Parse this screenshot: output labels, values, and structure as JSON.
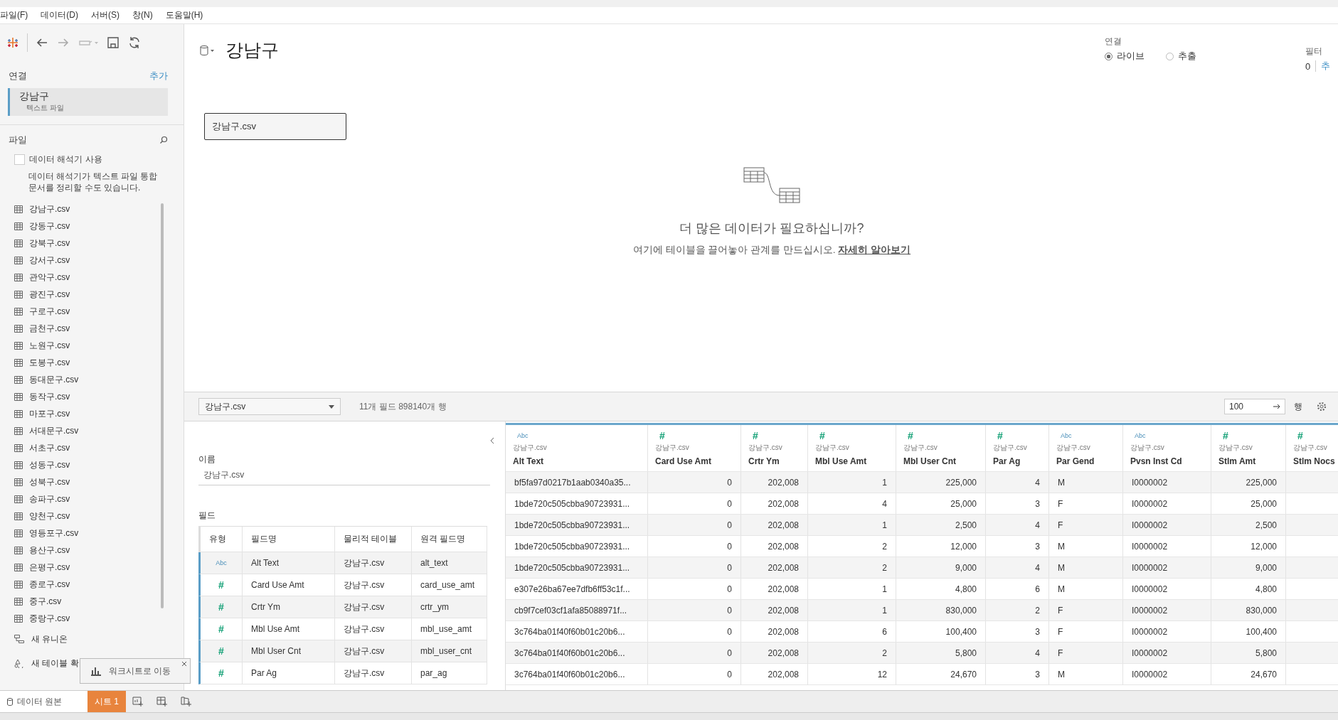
{
  "menu": [
    "파일(F)",
    "데이터(D)",
    "서버(S)",
    "창(N)",
    "도움말(H)"
  ],
  "connections": {
    "title": "연결",
    "add": "추가",
    "items": [
      {
        "name": "강남구",
        "type": "텍스트 파일",
        "selected": true
      }
    ]
  },
  "files": {
    "title": "파일",
    "interpreter": {
      "label": "데이터 해석기 사용",
      "checked": false,
      "note": "데이터 해석기가 텍스트 파일 통합 문서를 정리할 수도 있습니다."
    },
    "items": [
      "강남구.csv",
      "강동구.csv",
      "강북구.csv",
      "강서구.csv",
      "관악구.csv",
      "광진구.csv",
      "구로구.csv",
      "금천구.csv",
      "노원구.csv",
      "도봉구.csv",
      "동대문구.csv",
      "동작구.csv",
      "마포구.csv",
      "서대문구.csv",
      "서초구.csv",
      "성동구.csv",
      "성북구.csv",
      "송파구.csv",
      "양천구.csv",
      "영등포구.csv",
      "용산구.csv",
      "은평구.csv",
      "종로구.csv",
      "중구.csv",
      "중랑구.csv"
    ],
    "actions": [
      {
        "kind": "union",
        "label": "새 유니온"
      },
      {
        "kind": "extension",
        "label": "새 테이블 확"
      }
    ]
  },
  "header": {
    "title": "강남구",
    "connection": {
      "label": "연결",
      "options": [
        {
          "label": "라이브",
          "selected": true
        },
        {
          "label": "추출",
          "selected": false
        }
      ]
    },
    "filter": {
      "label": "필터",
      "count": "0",
      "add": "추"
    }
  },
  "canvas": {
    "tables": [
      "강남구.csv"
    ],
    "prompt": "더 많은 데이터가 필요하십니까?",
    "hint": "여기에 테이블을 끌어놓아 관계를 만드십시오.",
    "link": "자세히 알아보기"
  },
  "grid_bar": {
    "table": "강남구.csv",
    "summary": "11개 필드 898140개 행",
    "rows_value": "100",
    "rows_label": "행"
  },
  "metadata": {
    "name_label": "이름",
    "name_value": "강남구.csv",
    "fields_label": "필드",
    "columns": [
      "유형",
      "필드명",
      "물리적 테이블",
      "원격 필드명"
    ],
    "rows": [
      {
        "kind": "text",
        "type_label": "Abc",
        "name": "Alt Text",
        "table": "강남구.csv",
        "remote": "alt_text"
      },
      {
        "kind": "number",
        "type_label": "#",
        "name": "Card Use Amt",
        "table": "강남구.csv",
        "remote": "card_use_amt"
      },
      {
        "kind": "number",
        "type_label": "#",
        "name": "Crtr Ym",
        "table": "강남구.csv",
        "remote": "crtr_ym"
      },
      {
        "kind": "number",
        "type_label": "#",
        "name": "Mbl Use Amt",
        "table": "강남구.csv",
        "remote": "mbl_use_amt"
      },
      {
        "kind": "number",
        "type_label": "#",
        "name": "Mbl User Cnt",
        "table": "강남구.csv",
        "remote": "mbl_user_cnt"
      },
      {
        "kind": "number",
        "type_label": "#",
        "name": "Par Ag",
        "table": "강남구.csv",
        "remote": "par_ag"
      }
    ]
  },
  "grid": {
    "columns": [
      {
        "kind": "text",
        "type_label": "Abc",
        "source": "강남구.csv",
        "name": "Alt Text"
      },
      {
        "kind": "number",
        "type_label": "#",
        "source": "강남구.csv",
        "name": "Card Use Amt"
      },
      {
        "kind": "number",
        "type_label": "#",
        "source": "강남구.csv",
        "name": "Crtr Ym"
      },
      {
        "kind": "number",
        "type_label": "#",
        "source": "강남구.csv",
        "name": "Mbl Use Amt"
      },
      {
        "kind": "number",
        "type_label": "#",
        "source": "강남구.csv",
        "name": "Mbl User Cnt"
      },
      {
        "kind": "number",
        "type_label": "#",
        "source": "강남구.csv",
        "name": "Par Ag"
      },
      {
        "kind": "text",
        "type_label": "Abc",
        "source": "강남구.csv",
        "name": "Par Gend"
      },
      {
        "kind": "text",
        "type_label": "Abc",
        "source": "강남구.csv",
        "name": "Pvsn Inst Cd"
      },
      {
        "kind": "number",
        "type_label": "#",
        "source": "강남구.csv",
        "name": "Stlm Amt"
      },
      {
        "kind": "number",
        "type_label": "#",
        "source": "강남구.csv",
        "name": "Stlm Nocs"
      }
    ],
    "rows": [
      [
        "bf5fa97d0217b1aab0340a35...",
        "0",
        "202,008",
        "1",
        "225,000",
        "4",
        "M",
        "I0000002",
        "225,000"
      ],
      [
        "1bde720c505cbba90723931...",
        "0",
        "202,008",
        "4",
        "25,000",
        "3",
        "F",
        "I0000002",
        "25,000"
      ],
      [
        "1bde720c505cbba90723931...",
        "0",
        "202,008",
        "1",
        "2,500",
        "4",
        "F",
        "I0000002",
        "2,500"
      ],
      [
        "1bde720c505cbba90723931...",
        "0",
        "202,008",
        "2",
        "12,000",
        "3",
        "M",
        "I0000002",
        "12,000"
      ],
      [
        "1bde720c505cbba90723931...",
        "0",
        "202,008",
        "2",
        "9,000",
        "4",
        "M",
        "I0000002",
        "9,000"
      ],
      [
        "e307e26ba67ee7dfb6ff53c1f...",
        "0",
        "202,008",
        "1",
        "4,800",
        "6",
        "M",
        "I0000002",
        "4,800"
      ],
      [
        "cb9f7cef03cf1afa85088971f...",
        "0",
        "202,008",
        "1",
        "830,000",
        "2",
        "F",
        "I0000002",
        "830,000"
      ],
      [
        "3c764ba01f40f60b01c20b6...",
        "0",
        "202,008",
        "6",
        "100,400",
        "3",
        "F",
        "I0000002",
        "100,400"
      ],
      [
        "3c764ba01f40f60b01c20b6...",
        "0",
        "202,008",
        "2",
        "5,800",
        "4",
        "F",
        "I0000002",
        "5,800"
      ],
      [
        "3c764ba01f40f60b01c20b6...",
        "0",
        "202,008",
        "12",
        "24,670",
        "3",
        "M",
        "I0000002",
        "24,670"
      ]
    ]
  },
  "sheet_tabs": [
    {
      "kind": "source",
      "label": "데이터 원본",
      "selected": false
    },
    {
      "kind": "sheet",
      "label": "시트 1",
      "selected": true
    }
  ],
  "tooltip": {
    "text": "워크시트로 이동"
  }
}
